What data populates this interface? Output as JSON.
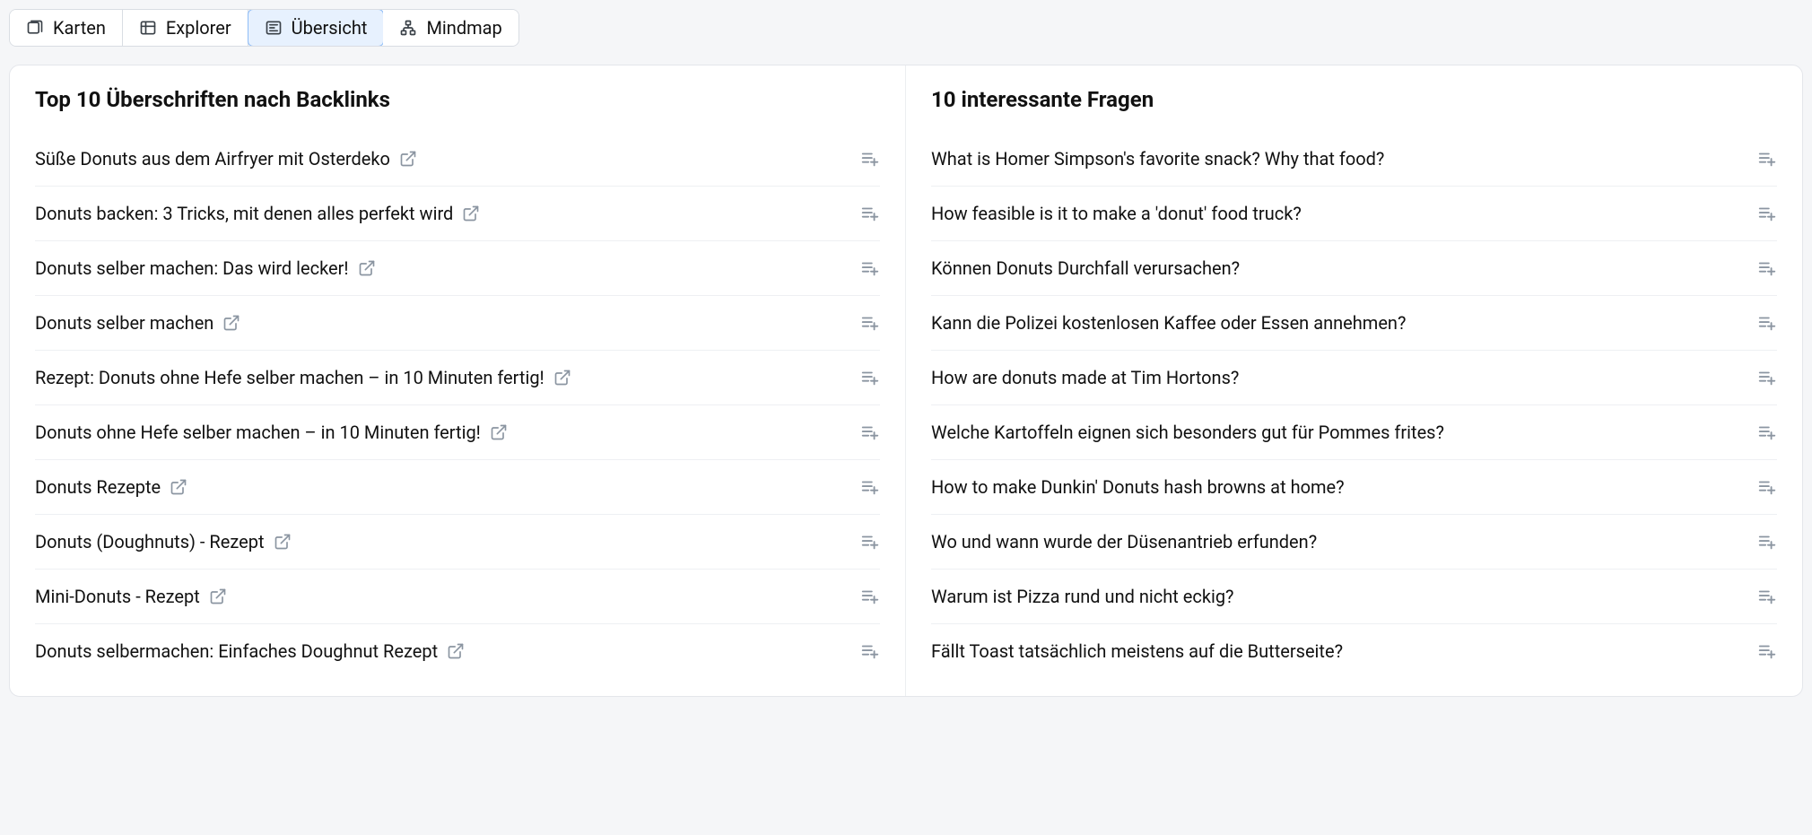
{
  "tabs": [
    {
      "label": "Karten",
      "icon": "cards-icon"
    },
    {
      "label": "Explorer",
      "icon": "table-icon"
    },
    {
      "label": "Übersicht",
      "icon": "newspaper-icon"
    },
    {
      "label": "Mindmap",
      "icon": "tree-icon"
    }
  ],
  "active_tab_index": 2,
  "left_panel": {
    "title": "Top 10 Überschriften nach Backlinks",
    "items": [
      "Süße Donuts aus dem Airfryer mit Osterdeko",
      "Donuts backen: 3 Tricks, mit denen alles perfekt wird",
      "Donuts selber machen: Das wird lecker!",
      "Donuts selber machen",
      "Rezept: Donuts ohne Hefe selber machen – in 10 Minuten fertig!",
      "Donuts ohne Hefe selber machen – in 10 Minuten fertig!",
      "Donuts Rezepte",
      "Donuts (Doughnuts) - Rezept",
      "Mini-Donuts - Rezept",
      "Donuts selbermachen: Einfaches Doughnut Rezept"
    ]
  },
  "right_panel": {
    "title": "10 interessante Fragen",
    "items": [
      "What is Homer Simpson's favorite snack? Why that food?",
      "How feasible is it to make a 'donut' food truck?",
      "Können Donuts Durchfall verursachen?",
      "Kann die Polizei kostenlosen Kaffee oder Essen annehmen?",
      "How are donuts made at Tim Hortons?",
      "Welche Kartoffeln eignen sich besonders gut für Pommes frites?",
      "How to make Dunkin' Donuts hash browns at home?",
      "Wo und wann wurde der Düsenantrieb erfunden?",
      "Warum ist Pizza rund und nicht eckig?",
      "Fällt Toast tatsächlich meistens auf die Butterseite?"
    ]
  }
}
